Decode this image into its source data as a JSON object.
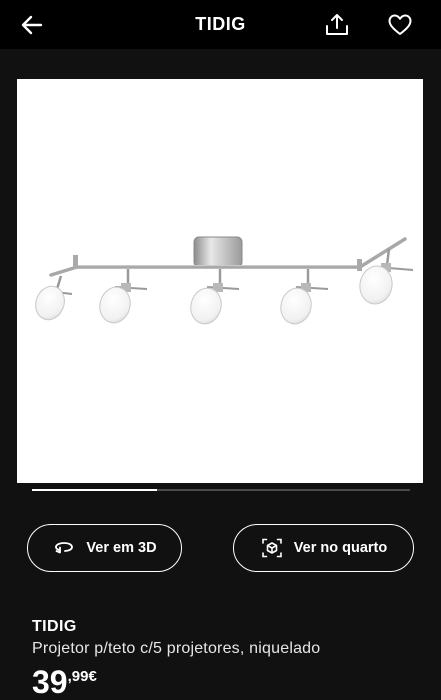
{
  "header": {
    "title": "TIDIG",
    "back_icon": "arrow-left-icon",
    "share_icon": "share-icon",
    "favorite_icon": "heart-icon"
  },
  "gallery": {
    "image": "ceiling-track-spotlight-5-lamps",
    "progress": 0.33
  },
  "actions": {
    "view_3d_label": "Ver em 3D",
    "view_3d_icon": "rotate-3d-icon",
    "view_in_room_label": "Ver no quarto",
    "view_in_room_icon": "ar-cube-icon"
  },
  "product": {
    "name": "TIDIG",
    "description": "Projetor p/teto c/5 projetores, niquelado",
    "price_integer": "39",
    "price_decimal": ",99€"
  },
  "colors": {
    "background": "#111111",
    "header": "#000000",
    "accent": "#ffffff"
  }
}
